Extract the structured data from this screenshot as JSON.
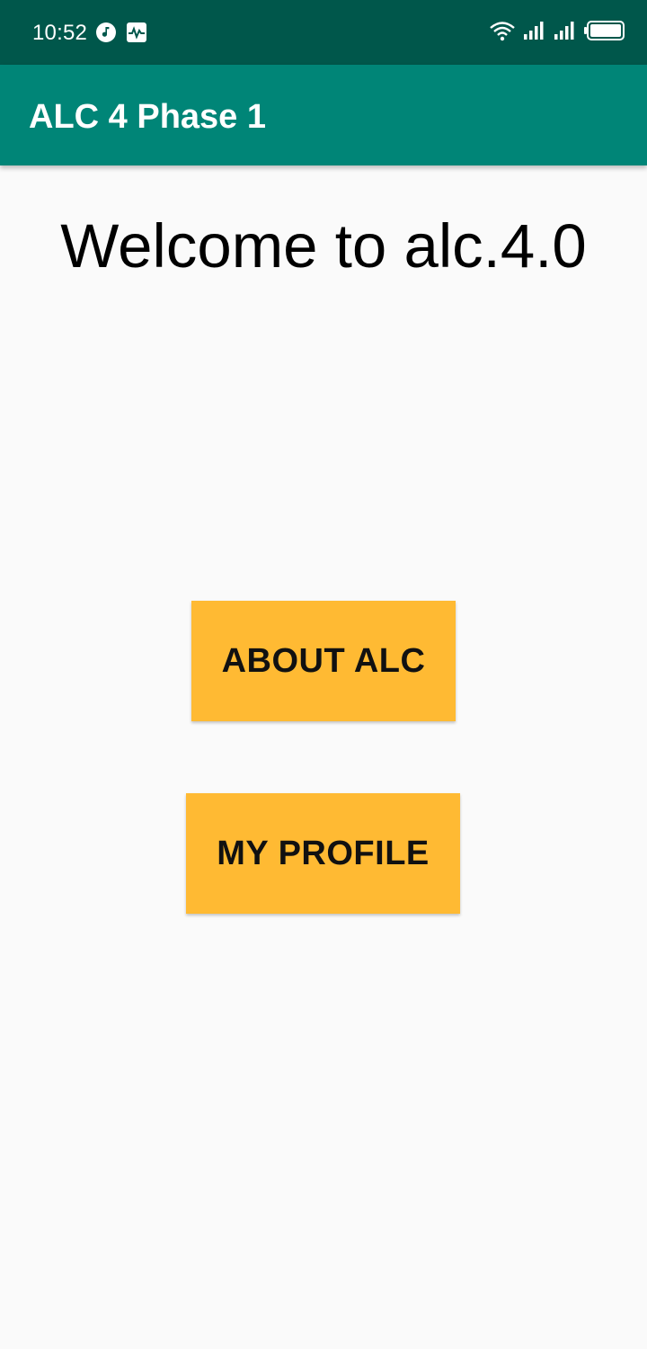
{
  "status_bar": {
    "time": "10:52",
    "left_icons": [
      "music-note-icon",
      "activity-monitor-icon"
    ],
    "right_icons": [
      "wifi-icon",
      "signal-icon",
      "signal-icon",
      "battery-icon"
    ],
    "background": "#00574b"
  },
  "app_bar": {
    "title": "ALC 4 Phase 1",
    "background": "#008577"
  },
  "main": {
    "welcome_text": "Welcome to alc.4.0",
    "buttons": [
      {
        "label": "ABOUT ALC"
      },
      {
        "label": "MY PROFILE"
      }
    ],
    "button_color": "#ffba33"
  }
}
